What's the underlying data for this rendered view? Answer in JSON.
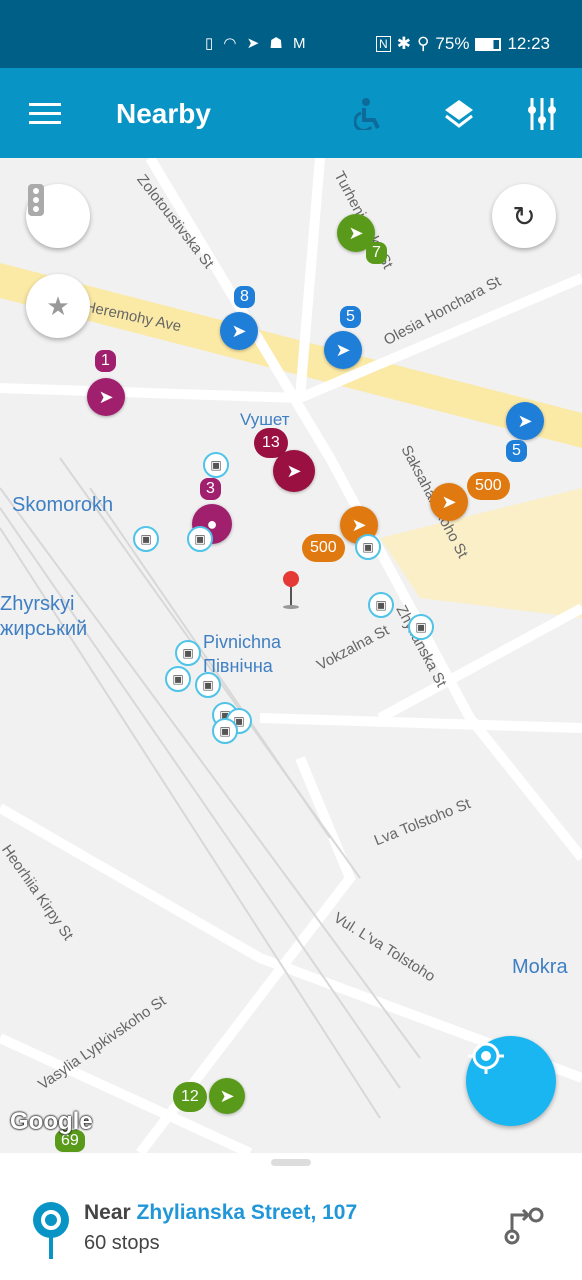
{
  "status_bar": {
    "notification_icons": [
      "sim-alert-icon",
      "wifi-icon",
      "telegram-icon",
      "app-icon",
      "gmail-icon"
    ],
    "nfc": "N",
    "battery": "75%",
    "time": "12:23"
  },
  "app_bar": {
    "title": "Nearby",
    "icons": [
      "menu-icon",
      "wheelchair-icon",
      "layers-icon",
      "filter-icon"
    ]
  },
  "map": {
    "streets": [
      "Zolotoustivska St",
      "Turhenievska St",
      "Zhylianska St",
      "Olesia Honchara St",
      "Heremohy Ave",
      "Saksahanskoho St",
      "Zhylianska St",
      "Vokzalna St",
      "Lva Tolstoho St",
      "Vul. L'va Tolstoho",
      "Heorhiia Kirpy St",
      "Vasylia Lypkivskoho St"
    ],
    "places": [
      "Skomorokh",
      "Zhyrskyi",
      "жирський",
      "Pivnichna",
      "Північна",
      "Vyшет",
      "Mokra"
    ],
    "markers": [
      {
        "label": "7",
        "color": "#5a9a1a"
      },
      {
        "label": "8",
        "color": "#1e7ed8"
      },
      {
        "label": "5",
        "color": "#1e7ed8"
      },
      {
        "label": "1",
        "color": "#a0206e"
      },
      {
        "label": "13",
        "color": "#9a1040"
      },
      {
        "label": "3",
        "color": "#a0206e"
      },
      {
        "label": "5",
        "color": "#1e7ed8"
      },
      {
        "label": "500",
        "color": "#e07a10"
      },
      {
        "label": "500",
        "color": "#e07a10"
      },
      {
        "label": "12",
        "color": "#5a9a1a"
      },
      {
        "label": "69",
        "color": "#5a9a1a"
      }
    ],
    "logo": "Google"
  },
  "bottom_sheet": {
    "prefix": "Near",
    "street": "Zhylianska Street, 107",
    "stops": "60 stops"
  }
}
